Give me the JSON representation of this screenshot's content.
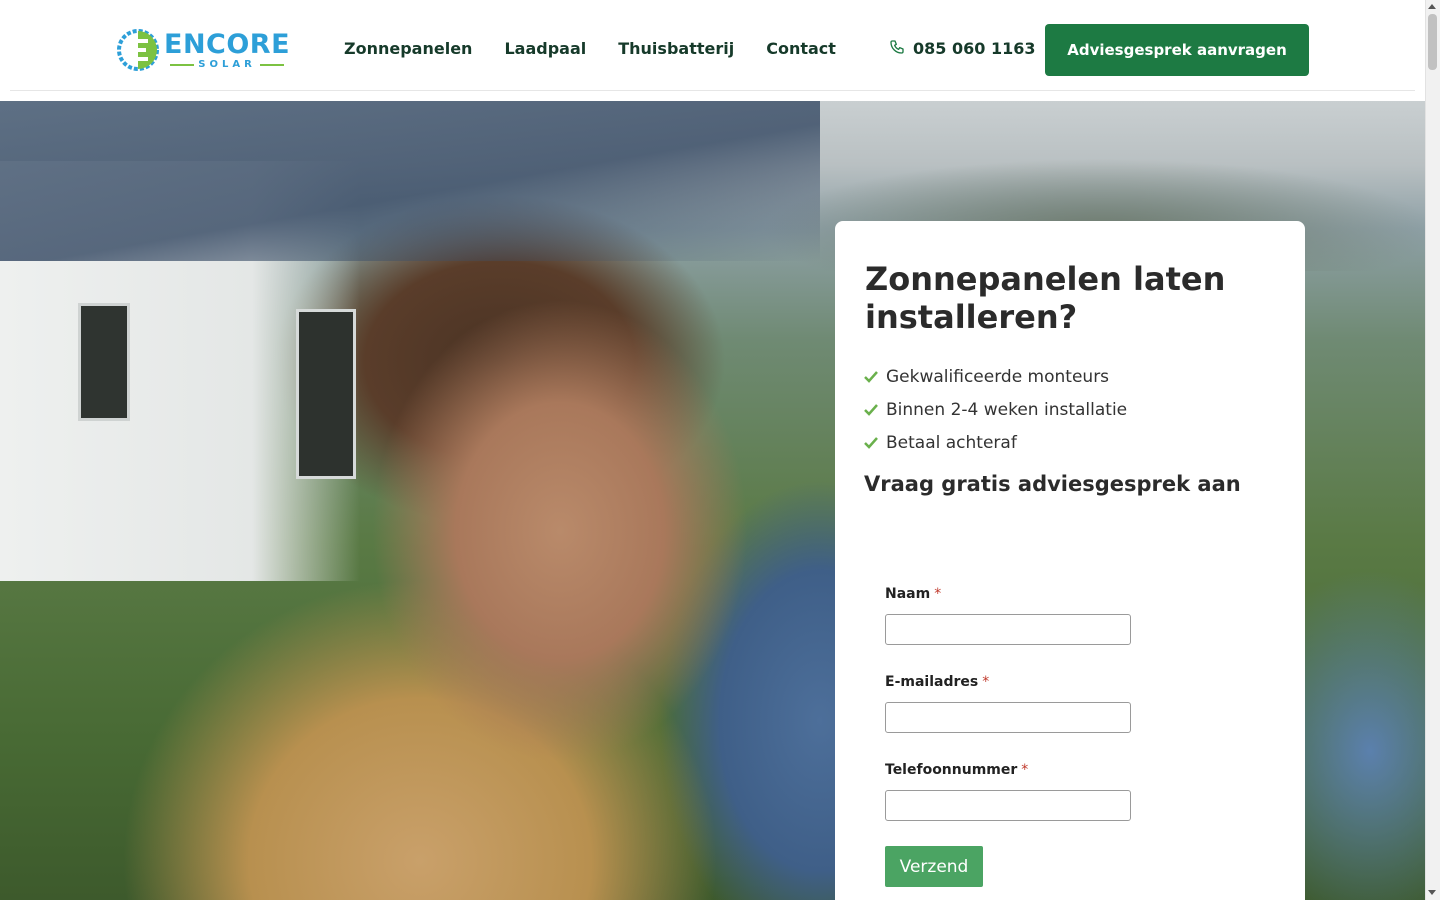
{
  "header": {
    "logo": {
      "word": "ENCORE",
      "sub": "SOLAR",
      "icon": "encore-solar-logo-icon"
    },
    "nav": [
      "Zonnepanelen",
      "Laadpaal",
      "Thuisbatterij",
      "Contact"
    ],
    "phone": {
      "icon": "phone-icon",
      "number": "085 060 1163"
    },
    "cta_label": "Adviesgesprek aanvragen"
  },
  "hero": {
    "image": "man-and-child-in-front-of-house-with-solar-panels",
    "title": "Zonnepanelen laten installeren?",
    "usps": [
      "Gekwalificeerde monteurs",
      "Binnen 2-4 weken installatie",
      "Betaal achteraf"
    ],
    "usp_icon": "checkmark-icon",
    "form_title": "Vraag gratis adviesgesprek aan",
    "form": {
      "fields": [
        {
          "label": "Naam",
          "required": "*",
          "value": ""
        },
        {
          "label": "E-mailadres",
          "required": "*",
          "value": ""
        },
        {
          "label": "Telefoonnummer",
          "required": "*",
          "value": ""
        }
      ],
      "submit_label": "Verzend"
    }
  },
  "colors": {
    "primary_green": "#1d7a43",
    "submit_green": "#4ba463",
    "check_green": "#6ab04c",
    "logo_blue": "#2d9fd8",
    "logo_green": "#7cc242",
    "nav_text": "#163a2a"
  }
}
